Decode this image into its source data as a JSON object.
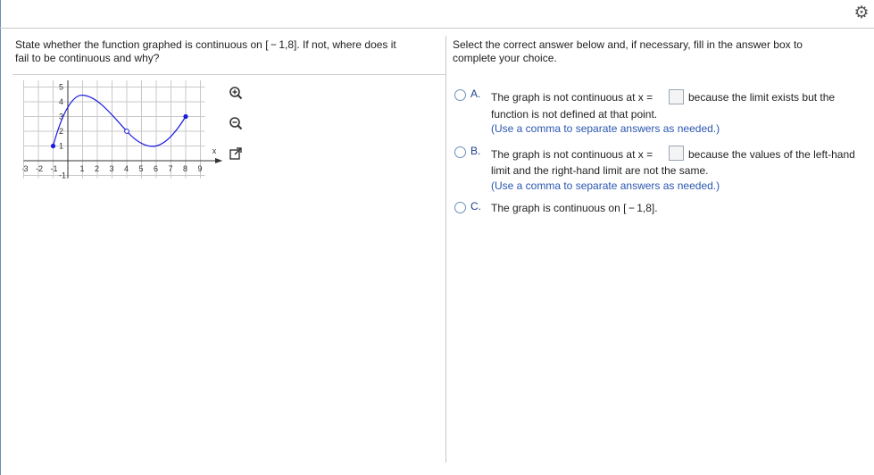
{
  "question": {
    "text_line1": "State whether the function graphed is continuous on [ − 1,8]. If not, where does it",
    "text_line2": "fail to be continuous and why?"
  },
  "instructions": {
    "line1": "Select the correct answer below and, if necessary, fill in the answer box to",
    "line2": "complete your choice."
  },
  "graph": {
    "x_axis_label": "x",
    "y_axis_label": "y",
    "x_ticks": [
      "-3",
      "-2",
      "-1",
      "1",
      "2",
      "3",
      "4",
      "5",
      "6",
      "7",
      "8",
      "9"
    ],
    "y_ticks": [
      "5",
      "4",
      "3",
      "2",
      "1",
      "-1"
    ],
    "curve_color": "#1a1adf"
  },
  "tools": [
    "zoom-in-icon",
    "zoom-out-icon",
    "popout-icon"
  ],
  "options": {
    "a": {
      "letter": "A.",
      "text_before": "The graph is not continuous at x =",
      "text_after": "because the limit exists but the",
      "text_line2": "function is not defined at that point.",
      "note": "(Use a comma to separate answers as needed.)"
    },
    "b": {
      "letter": "B.",
      "text_before": "The graph is not continuous at x =",
      "text_after": "because the values of the left-hand",
      "text_line2": "limit and the right-hand limit are not the same.",
      "note": "(Use a comma to separate answers as needed.)"
    },
    "c": {
      "letter": "C.",
      "text": "The graph is continuous on [ − 1,8]."
    }
  },
  "colors": {
    "accent": "#1f3e8a",
    "note": "#2a56b0",
    "curve": "#1a1adf"
  }
}
